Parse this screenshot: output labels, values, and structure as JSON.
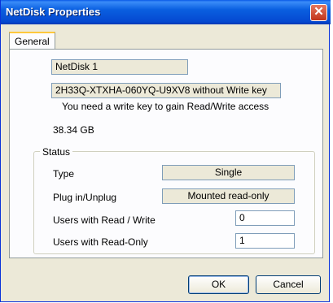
{
  "window": {
    "title": "NetDisk Properties",
    "close_glyph": "✕"
  },
  "tabs": [
    {
      "label": "General"
    }
  ],
  "general": {
    "disk_name": "NetDisk 1",
    "disk_id": "2H33Q-XTXHA-060YQ-U9XV8  without Write key",
    "notice": "You need a write key to gain Read/Write access",
    "capacity": "38.34 GB"
  },
  "status": {
    "title": "Status",
    "type_label": "Type",
    "type_value": "Single",
    "plug_label": "Plug in/Unplug",
    "plug_value": "Mounted read-only",
    "rw_users_label": "Users with Read / Write",
    "rw_users_value": "0",
    "ro_users_label": "Users with Read-Only",
    "ro_users_value": "1"
  },
  "buttons": {
    "ok": "OK",
    "cancel": "Cancel"
  }
}
